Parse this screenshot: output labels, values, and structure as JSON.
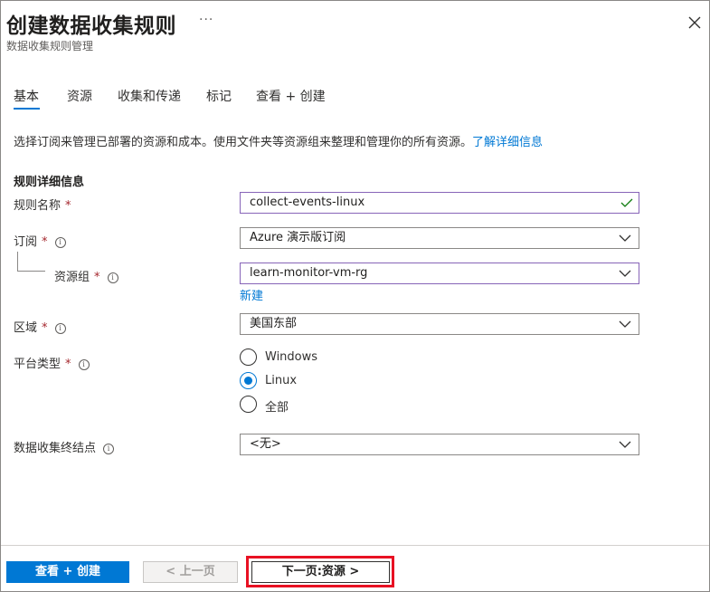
{
  "header": {
    "title": "创建数据收集规则",
    "more_label": "···",
    "subtitle": "数据收集规则管理"
  },
  "tabs": [
    {
      "label": "基本"
    },
    {
      "label": "资源"
    },
    {
      "label": "收集和传递"
    },
    {
      "label": "标记"
    },
    {
      "label": "查看 + 创建"
    }
  ],
  "description": {
    "text": "选择订阅来管理已部署的资源和成本。使用文件夹等资源组来整理和管理你的所有资源。",
    "link": "了解详细信息"
  },
  "form": {
    "section_title": "规则详细信息",
    "required_mark": "*",
    "info_glyph": "i",
    "rule_name": {
      "label": "规则名称",
      "value": "collect-events-linux"
    },
    "subscription": {
      "label": "订阅",
      "value": "Azure 演示版订阅"
    },
    "resource_group": {
      "label": "资源组",
      "value": "learn-monitor-vm-rg",
      "new_link": "新建"
    },
    "region": {
      "label": "区域",
      "value": "美国东部"
    },
    "platform": {
      "label": "平台类型",
      "options": [
        "Windows",
        "Linux",
        "全部"
      ],
      "selected": "Linux"
    },
    "endpoint": {
      "label": "数据收集终结点",
      "value": "<无>"
    }
  },
  "footer": {
    "review_create": "查看 + 创建",
    "previous": "< 上一页",
    "next": "下一页:资源 >"
  },
  "colors": {
    "accent": "#0078d4",
    "focus_border": "#8764b8",
    "highlight": "#e81123",
    "required": "#a4262c",
    "valid": "#107c10"
  }
}
